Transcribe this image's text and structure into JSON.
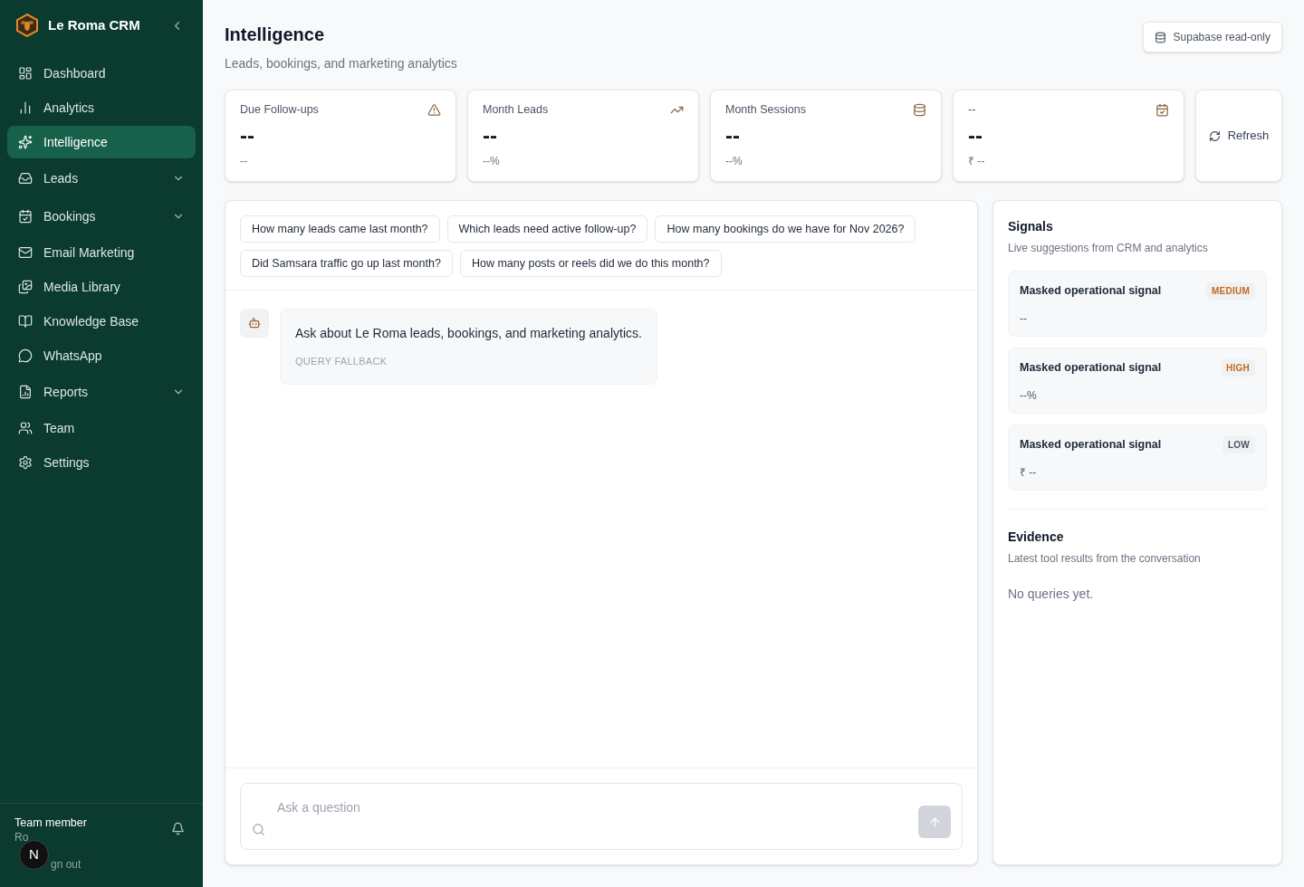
{
  "sidebar": {
    "brand": "Le Roma CRM",
    "items": [
      {
        "label": "Dashboard",
        "selected": false,
        "expandable": false
      },
      {
        "label": "Analytics",
        "selected": false,
        "expandable": false
      },
      {
        "label": "Intelligence",
        "selected": true,
        "expandable": false
      },
      {
        "label": "Leads",
        "selected": false,
        "expandable": true
      },
      {
        "label": "Bookings",
        "selected": false,
        "expandable": true
      },
      {
        "label": "Email Marketing",
        "selected": false,
        "expandable": false
      },
      {
        "label": "Media Library",
        "selected": false,
        "expandable": false
      },
      {
        "label": "Knowledge Base",
        "selected": false,
        "expandable": false
      },
      {
        "label": "WhatsApp",
        "selected": false,
        "expandable": false
      },
      {
        "label": "Reports",
        "selected": false,
        "expandable": true
      },
      {
        "label": "Team",
        "selected": false,
        "expandable": false
      },
      {
        "label": "Settings",
        "selected": false,
        "expandable": false
      }
    ],
    "user": {
      "name": "Team member",
      "role": "Ro",
      "sign_out": "gn out",
      "avatar": "N"
    }
  },
  "header": {
    "title": "Intelligence",
    "subtitle": "Leads, bookings, and marketing analytics",
    "source_badge": "Supabase read-only"
  },
  "stats": [
    {
      "label": "Due Follow-ups",
      "value": "--",
      "note": "--"
    },
    {
      "label": "Month Leads",
      "value": "--",
      "note": "--%"
    },
    {
      "label": "Month Sessions",
      "value": "--",
      "note": "--%"
    },
    {
      "label": "--",
      "value": "--",
      "note": "₹ --"
    }
  ],
  "refresh": "Refresh",
  "chat": {
    "suggestions": [
      "How many leads came last month?",
      "Which leads need active follow-up?",
      "How many bookings do we have for Nov 2026?",
      "Did Samsara traffic go up last month?",
      "How many posts or reels did we do this month?"
    ],
    "messages": [
      {
        "text": "Ask about Le Roma leads, bookings, and marketing analytics.",
        "tag": "QUERY FALLBACK"
      }
    ],
    "input": {
      "placeholder": "Ask a question"
    }
  },
  "signals": {
    "title": "Signals",
    "subtitle": "Live suggestions from CRM and analytics",
    "items": [
      {
        "title": "Masked operational signal",
        "value": "--",
        "priority": "MEDIUM",
        "color": "#c2691f"
      },
      {
        "title": "Masked operational signal",
        "value": "--%",
        "priority": "HIGH",
        "color": "#c2691f"
      },
      {
        "title": "Masked operational signal",
        "value": "₹ --",
        "priority": "LOW",
        "color": "#4b5563"
      }
    ]
  },
  "evidence": {
    "title": "Evidence",
    "subtitle": "Latest tool results from the conversation",
    "empty": "No queries yet."
  }
}
